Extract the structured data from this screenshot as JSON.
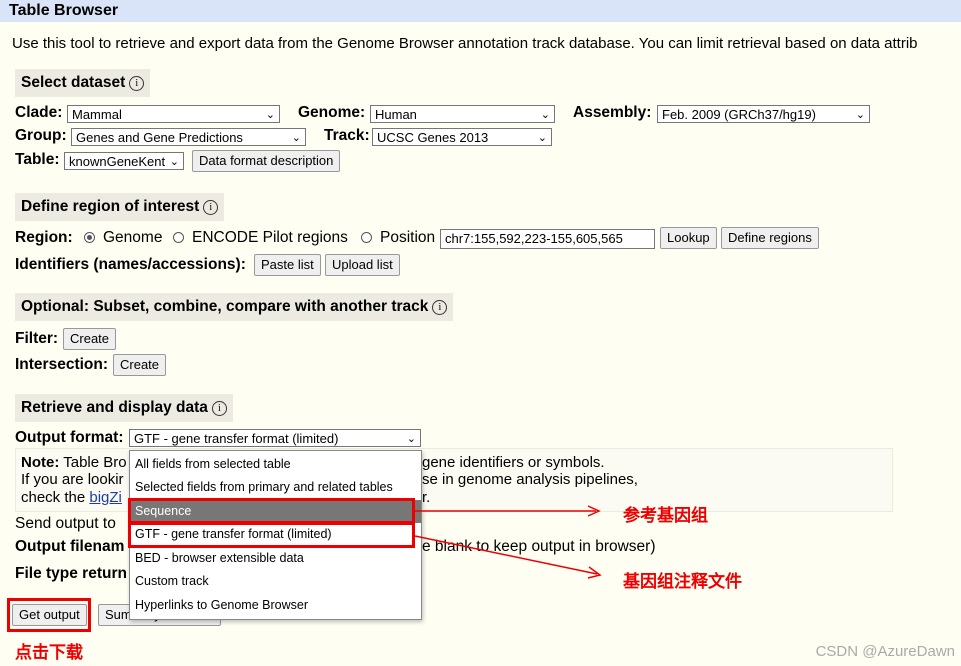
{
  "title": "Table Browser",
  "intro": "Use this tool to retrieve and export data from the Genome Browser annotation track database. You can limit retrieval based on data attrib",
  "select_dataset": {
    "heading": "Select dataset",
    "clade_label": "Clade:",
    "clade": "Mammal",
    "genome_label": "Genome:",
    "genome": "Human",
    "assembly_label": "Assembly:",
    "assembly": "Feb. 2009 (GRCh37/hg19)",
    "group_label": "Group:",
    "group": "Genes and Gene Predictions",
    "track_label": "Track:",
    "track": "UCSC Genes 2013",
    "table_label": "Table:",
    "table": "knownGeneKent",
    "data_format_button": "Data format description"
  },
  "region": {
    "heading": "Define region of interest",
    "region_label": "Region:",
    "opt_genome": "Genome",
    "opt_encode": "ENCODE Pilot regions",
    "opt_position": "Position",
    "position_value": "chr7:155,592,223-155,605,565",
    "lookup_button": "Lookup",
    "define_regions_button": "Define regions",
    "identifiers_label": "Identifiers (names/accessions):",
    "paste_list_button": "Paste list",
    "upload_list_button": "Upload list"
  },
  "optional": {
    "heading": "Optional: Subset, combine, compare with another track",
    "filter_label": "Filter:",
    "filter_button": "Create",
    "intersection_label": "Intersection:",
    "intersection_button": "Create"
  },
  "retrieve": {
    "heading": "Retrieve and display data",
    "output_format_label": "Output format:",
    "output_format_value": "GTF - gene transfer format (limited)",
    "note_bold": "Note:",
    "note_line1_a": "Table Bro",
    "note_line1_b": "gene identifiers or symbols.",
    "note_line2_a": "If you are lookir",
    "note_line2_b": "se in genome analysis pipelines,",
    "note_line3_a": "check the ",
    "note_line3_link": "bigZi",
    "note_line3_b": "r.",
    "send_output_label": "Send output to",
    "output_filename_label": "Output filenam",
    "output_filename_hint": "e blank to keep output in browser)",
    "file_type_label": "File type return",
    "get_output_button": "Get output",
    "summary_button": "Summary/statistics"
  },
  "dropdown_options": [
    "All fields from selected table",
    "Selected fields from primary and related tables",
    "Sequence",
    "GTF - gene transfer format (limited)",
    "BED - browser extensible data",
    "Custom track",
    "Hyperlinks to Genome Browser"
  ],
  "annotations": {
    "reference_genome": "参考基因组",
    "annotation_file": "基因组注释文件",
    "click_download": "点击下载"
  },
  "watermark": "CSDN @AzureDawn",
  "colors": {
    "annotation": "#e00000",
    "title_bar": "#d9e4f8",
    "page_bg": "#fffef2"
  }
}
